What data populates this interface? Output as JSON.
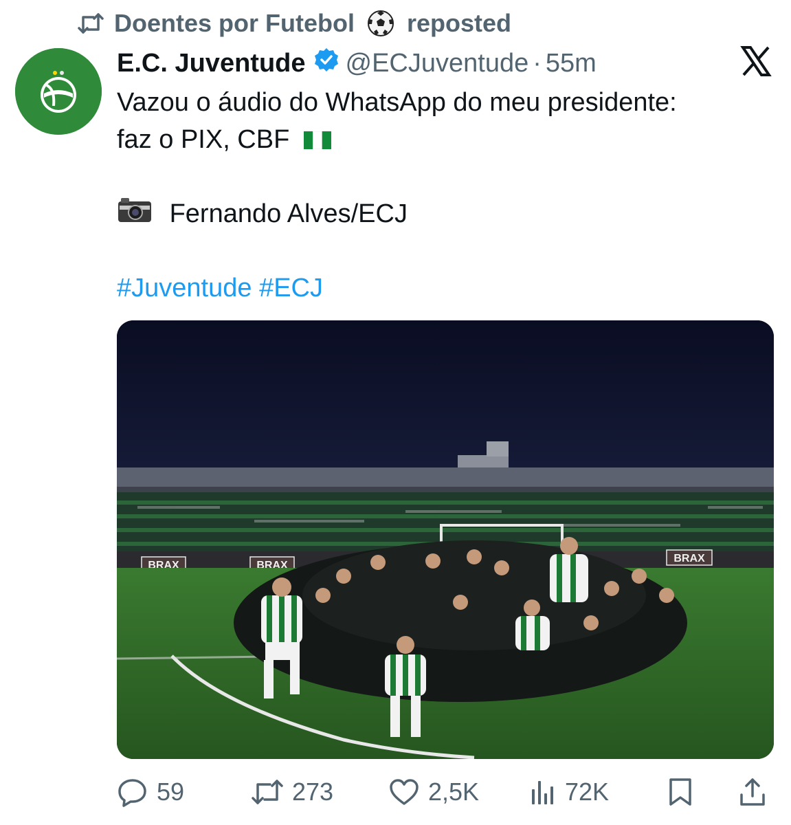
{
  "repost": {
    "icon": "repost-icon",
    "user": "Doentes por Futebol",
    "emoji": "soccer-ball-icon",
    "label": "reposted"
  },
  "author": {
    "name": "E.C. Juventude",
    "verified_icon": "verified-badge-icon",
    "handle": "@ECJuventude",
    "separator": "·",
    "time": "55m",
    "avatar_icon": "juventude-crest-avatar",
    "brand_color": "#2f8a3a"
  },
  "platform_icon": "x-logo-icon",
  "tweet": {
    "line1": "Vazou o áudio do WhatsApp do meu presidente:",
    "line2": "faz o PIX, CBF",
    "flag_icon": "nigeria-flag-icon",
    "camera_icon": "camera-icon",
    "credit": "Fernando Alves/ECJ",
    "hashtags": [
      "#Juventude",
      "#ECJ"
    ],
    "hashtag_color": "#1d9bf0"
  },
  "media": {
    "alt": "team-celebration-photo",
    "ad_boards": [
      "BRAX",
      "BRAX",
      "BRAX"
    ]
  },
  "actions": {
    "replies": "59",
    "reposts": "273",
    "likes": "2,5K",
    "views": "72K"
  },
  "colors": {
    "muted": "#536471",
    "text": "#0f1419"
  }
}
